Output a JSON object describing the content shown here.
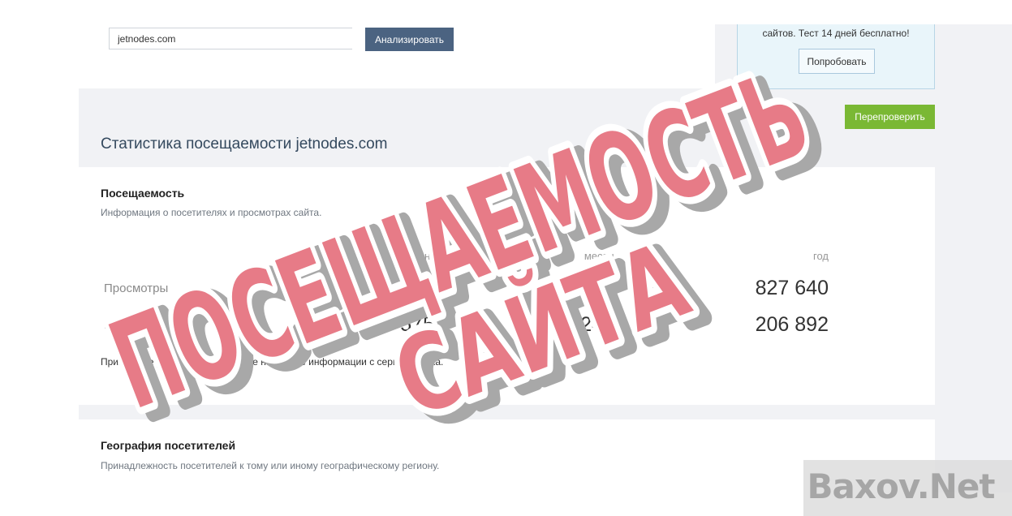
{
  "search": {
    "value": "jetnodes.com",
    "button_label": "Анализировать"
  },
  "promo": {
    "text": "сайтов. Тест 14 дней бесплатно!",
    "button_label": "Попробовать"
  },
  "recheck_label": "Перепроверить",
  "page_title": "Статистика посещаемости jetnodes.com",
  "traffic": {
    "heading": "Посещаемость",
    "subtitle": "Информация о посетителях и просмотрах сайта.",
    "columns": [
      "За день",
      "месяц",
      "год"
    ],
    "rows": [
      {
        "label": "Просмотры",
        "day": "2 299",
        "month": "68 970",
        "year": "827 640"
      },
      {
        "label": "Посетители",
        "day": "575",
        "month": "17 241",
        "year": "206 892"
      }
    ],
    "footnote": "Примерные данные, вычисленные на основе информации с сервиса Alexa."
  },
  "geo": {
    "heading": "География посетителей",
    "subtitle": "Принадлежность посетителей к тому или иному географическому региону."
  },
  "stamp": {
    "line1": "ПОСЕЩАЕМОСТЬ",
    "line2": "САЙТА",
    "fill_color": "#e5707d",
    "shadow_color": "#a8a8a8",
    "outline_color": "#ffffff"
  },
  "watermark": "Baxov.Net"
}
